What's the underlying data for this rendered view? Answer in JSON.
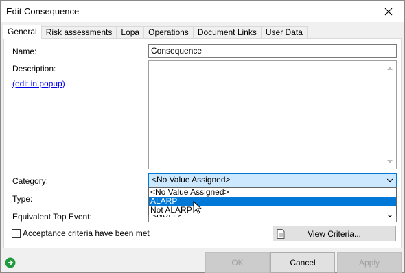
{
  "window": {
    "title": "Edit Consequence"
  },
  "tabs": [
    {
      "label": "General"
    },
    {
      "label": "Risk assessments"
    },
    {
      "label": "Lopa"
    },
    {
      "label": "Operations"
    },
    {
      "label": "Document Links"
    },
    {
      "label": "User Data"
    }
  ],
  "form": {
    "name_label": "Name:",
    "name_value": "Consequence",
    "description_label": "Description:",
    "edit_popup_link": "(edit in popup)",
    "category_label": "Category:",
    "category_value": "<No Value Assigned>",
    "type_label": "Type:",
    "equivalent_top_event_label": "Equivalent Top Event:",
    "equivalent_top_event_value": "<NULL>",
    "acceptance_label": "Acceptance criteria have been met",
    "view_criteria_label": "View Criteria..."
  },
  "dropdown": {
    "options": [
      "<No Value Assigned>",
      "ALARP",
      "Not ALARP"
    ],
    "highlighted": "ALARP"
  },
  "footer": {
    "ok": "OK",
    "cancel": "Cancel",
    "apply": "Apply"
  },
  "colors": {
    "accent": "#0078d7",
    "focus_bg": "#cce8ff",
    "status_green": "#1e9c3c"
  },
  "icons": {
    "close": "close-icon",
    "chevron": "chevron-down-icon",
    "document": "document-icon",
    "status": "go-arrow-icon",
    "cursor": "mouse-pointer-icon"
  }
}
